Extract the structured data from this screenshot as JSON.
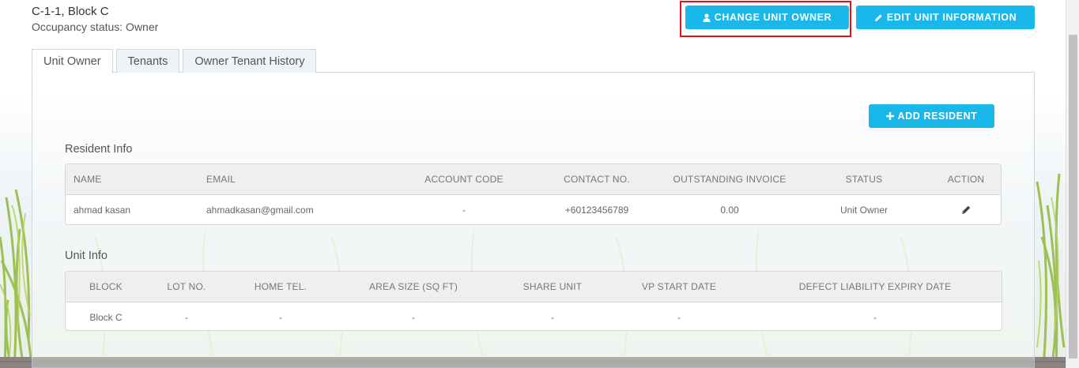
{
  "header": {
    "unit_title": "C-1-1, Block C",
    "occupancy_status": "Occupancy status: Owner"
  },
  "actions": {
    "change_owner_label": "CHANGE UNIT OWNER",
    "change_owner_icon": "user-icon",
    "edit_info_label": "EDIT UNIT INFORMATION",
    "edit_info_icon": "pencil-icon",
    "add_resident_label": "ADD RESIDENT",
    "add_resident_icon": "plus-icon"
  },
  "tabs": [
    {
      "label": "Unit Owner",
      "active": true
    },
    {
      "label": "Tenants",
      "active": false
    },
    {
      "label": "Owner Tenant History",
      "active": false
    }
  ],
  "resident_info": {
    "title": "Resident Info",
    "columns": [
      "NAME",
      "EMAIL",
      "ACCOUNT CODE",
      "CONTACT NO.",
      "OUTSTANDING INVOICE",
      "STATUS",
      "ACTION"
    ],
    "rows": [
      {
        "name": "ahmad kasan",
        "email": "ahmadkasan@gmail.com",
        "account_code": "-",
        "contact_no": "+60123456789",
        "outstanding_invoice": "0.00",
        "status": "Unit Owner",
        "action_icon": "pencil-icon"
      }
    ]
  },
  "unit_info": {
    "title": "Unit Info",
    "columns": [
      "BLOCK",
      "LOT NO.",
      "HOME TEL.",
      "AREA SIZE (SQ FT)",
      "SHARE UNIT",
      "VP START DATE",
      "DEFECT LIABILITY EXPIRY DATE"
    ],
    "rows": [
      {
        "block": "Block C",
        "lot_no": "-",
        "home_tel": "-",
        "area_size": "-",
        "share_unit": "-",
        "vp_start_date": "-",
        "defect_liability_expiry_date": "-"
      }
    ]
  },
  "colors": {
    "accent": "#1ab7ea",
    "highlight": "#e0111a"
  }
}
